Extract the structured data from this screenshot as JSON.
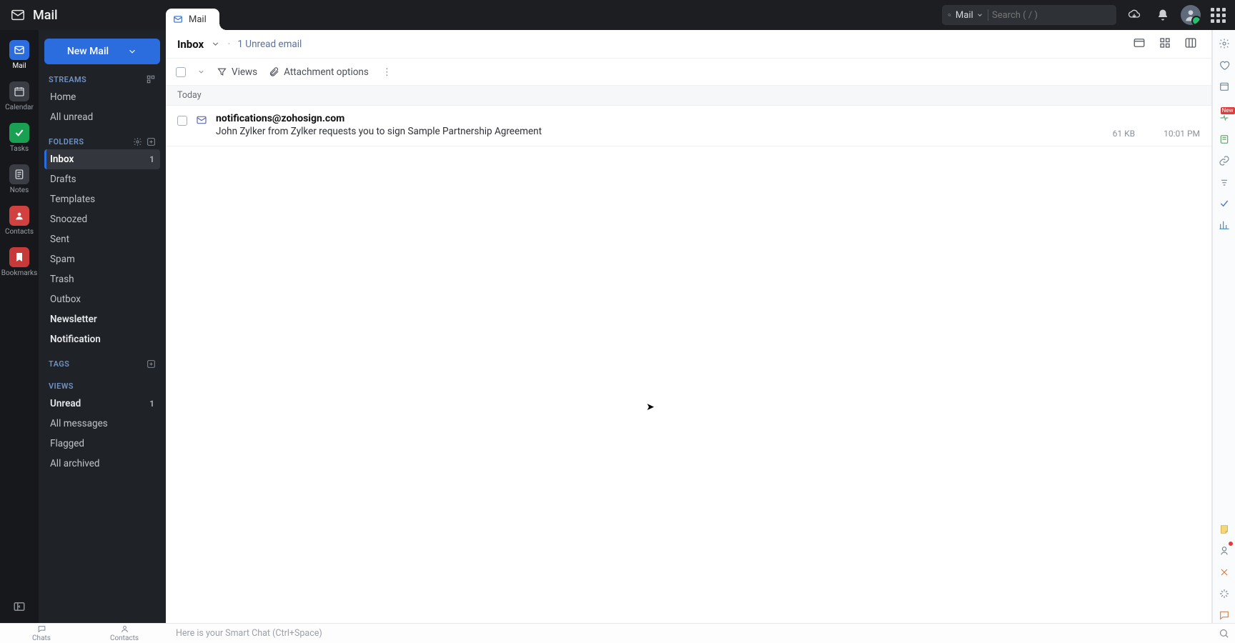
{
  "brand": {
    "name": "Mail"
  },
  "tab": {
    "label": "Mail"
  },
  "search": {
    "scope": "Mail",
    "placeholder": "Search ( / )"
  },
  "rail": {
    "items": [
      {
        "label": "Mail"
      },
      {
        "label": "Calendar"
      },
      {
        "label": "Tasks"
      },
      {
        "label": "Notes"
      },
      {
        "label": "Contacts"
      },
      {
        "label": "Bookmarks"
      }
    ]
  },
  "compose": {
    "label": "New Mail"
  },
  "sidebar": {
    "streams_h": "STREAMS",
    "streams": [
      {
        "label": "Home"
      },
      {
        "label": "All unread"
      }
    ],
    "folders_h": "FOLDERS",
    "folders": [
      {
        "label": "Inbox",
        "count": "1"
      },
      {
        "label": "Drafts"
      },
      {
        "label": "Templates"
      },
      {
        "label": "Snoozed"
      },
      {
        "label": "Sent"
      },
      {
        "label": "Spam"
      },
      {
        "label": "Trash"
      },
      {
        "label": "Outbox"
      },
      {
        "label": "Newsletter"
      },
      {
        "label": "Notification"
      }
    ],
    "tags_h": "TAGS",
    "views_h": "VIEWS",
    "views": [
      {
        "label": "Unread",
        "count": "1"
      },
      {
        "label": "All messages"
      },
      {
        "label": "Flagged"
      },
      {
        "label": "All archived"
      }
    ]
  },
  "main": {
    "title": "Inbox",
    "unread_text": "1 Unread email",
    "views_label": "Views",
    "attach_label": "Attachment options",
    "group": "Today"
  },
  "messages": [
    {
      "from": "notifications@zohosign.com",
      "subject": "John Zylker from Zylker requests you to sign Sample Partnership Agreement",
      "size": "61 KB",
      "time": "10:01 PM"
    }
  ],
  "rightrail": {
    "new_badge": "New"
  },
  "bottom": {
    "chats": "Chats",
    "contacts": "Contacts",
    "smart": "Here is your Smart Chat (Ctrl+Space)"
  }
}
